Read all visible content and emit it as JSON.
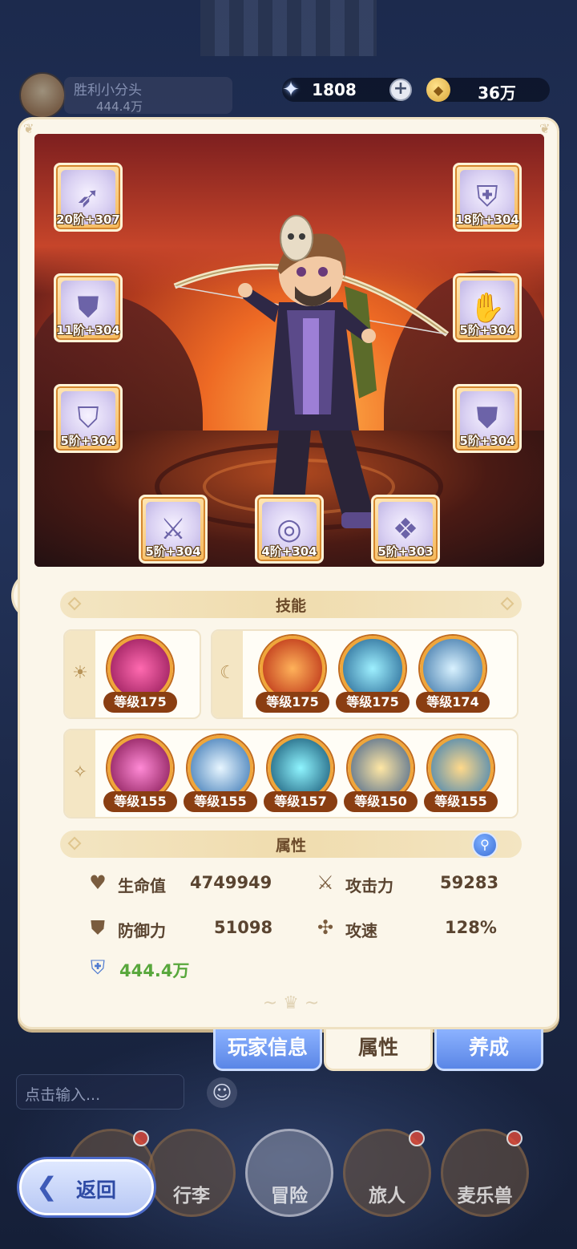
{
  "header": {
    "player_name": "胜利小分头",
    "player_power": "444.4万",
    "gems": "1808",
    "coins": "36万",
    "gem_icon": "gem-icon",
    "coin_icon": "coin-icon"
  },
  "equipment": [
    {
      "slot": "weapon",
      "label": "20阶+307",
      "icon": "bow-icon"
    },
    {
      "slot": "helmet",
      "label": "18阶+304",
      "icon": "helmet-icon"
    },
    {
      "slot": "shoulder",
      "label": "11阶+304",
      "icon": "armor-icon"
    },
    {
      "slot": "gloves",
      "label": "5阶+304",
      "icon": "gauntlet-icon"
    },
    {
      "slot": "chest",
      "label": "5阶+304",
      "icon": "armor-icon"
    },
    {
      "slot": "legs",
      "label": "5阶+304",
      "icon": "legs-icon"
    },
    {
      "slot": "boots",
      "label": "5阶+304",
      "icon": "boots-icon"
    },
    {
      "slot": "necklace",
      "label": "4阶+304",
      "icon": "necklace-icon"
    },
    {
      "slot": "amulet",
      "label": "5阶+303",
      "icon": "amulet-icon"
    }
  ],
  "skills_section": {
    "title": "技能",
    "group_sun": [
      {
        "level": "等级175"
      }
    ],
    "group_moon": [
      {
        "level": "等级175"
      },
      {
        "level": "等级175"
      },
      {
        "level": "等级174"
      }
    ],
    "group_star": [
      {
        "level": "等级155"
      },
      {
        "level": "等级155"
      },
      {
        "level": "等级157"
      },
      {
        "level": "等级150"
      },
      {
        "level": "等级155"
      }
    ]
  },
  "attributes_section": {
    "title": "属性",
    "hp_label": "生命值",
    "hp_value": "4749949",
    "atk_label": "攻击力",
    "atk_value": "59283",
    "def_label": "防御力",
    "def_value": "51098",
    "spd_label": "攻速",
    "spd_value": "128%",
    "power_value": "444.4万"
  },
  "tabs": {
    "player_info": "玩家信息",
    "attributes": "属性",
    "develop": "养成"
  },
  "chat": {
    "placeholder": "点击输入..."
  },
  "nav": {
    "items": [
      "",
      "行李",
      "冒险",
      "旅人",
      "麦乐兽"
    ],
    "back_label": "返回"
  },
  "colors": {
    "panel_bg": "#fbf6ea",
    "skill_ring": "#f0a63a",
    "level_badge": "#8a3e12",
    "power_green": "#58a73c",
    "tab_blue": "#5a86e6"
  }
}
